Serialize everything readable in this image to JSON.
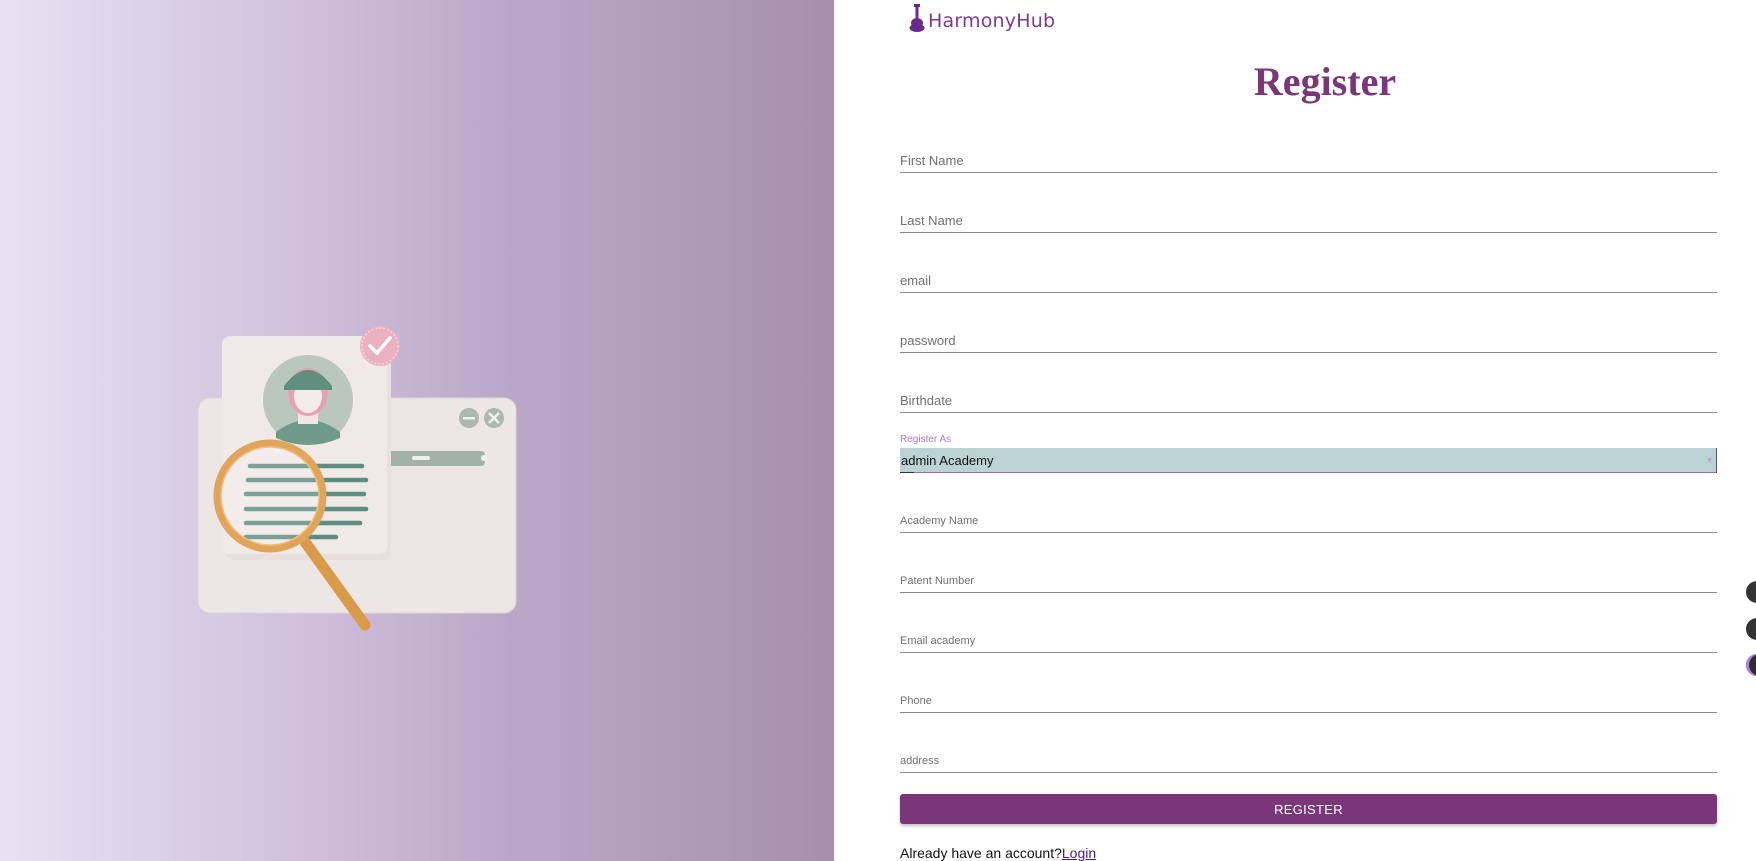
{
  "brand": {
    "name": "HarmonyHub",
    "logo_icon": "guitar-icon"
  },
  "form": {
    "title": "Register",
    "fields": {
      "first_name": {
        "placeholder": "First Name",
        "value": ""
      },
      "last_name": {
        "placeholder": "Last Name",
        "value": ""
      },
      "email": {
        "placeholder": "email",
        "value": ""
      },
      "password": {
        "placeholder": "password",
        "value": ""
      },
      "birthdate": {
        "placeholder": "Birthdate",
        "value": ""
      },
      "academy_name": {
        "placeholder": "Academy Name",
        "value": ""
      },
      "patent_number": {
        "placeholder": "Patent Number",
        "value": ""
      },
      "email_academy": {
        "placeholder": "Email academy",
        "value": ""
      },
      "phone": {
        "placeholder": "Phone",
        "value": ""
      },
      "address": {
        "placeholder": "address",
        "value": ""
      }
    },
    "register_as": {
      "label": "Register As",
      "selected": "admin Academy"
    },
    "submit_label": "REGISTER",
    "login_prompt": "Already have an account?",
    "login_link": "Login"
  },
  "colors": {
    "accent": "#7b3679",
    "select_background": "#bcd3d6",
    "gradient_start": "#e6e2f3",
    "gradient_end": "#a68fad"
  },
  "illustration": {
    "icon": "profile-search-illustration"
  }
}
